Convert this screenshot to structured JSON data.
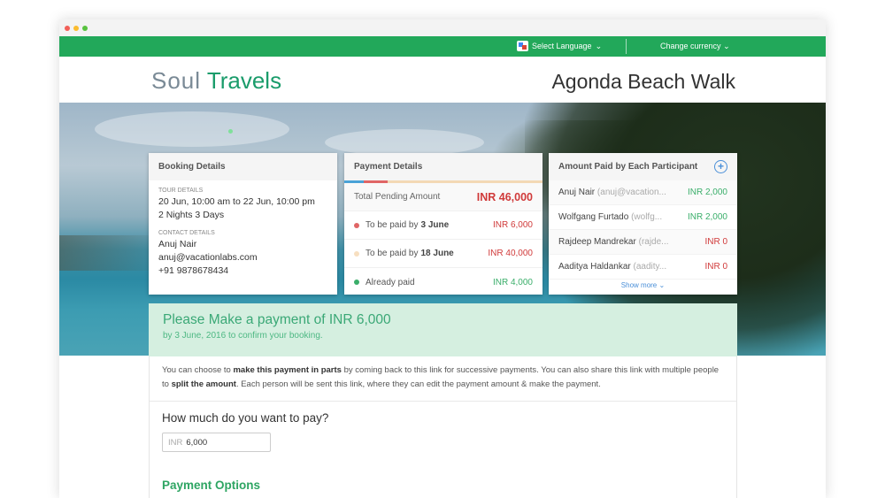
{
  "topbar": {
    "language_label": "Select Language",
    "currency_label": "Change currency"
  },
  "header": {
    "logo_part1": "Soul",
    "logo_part2": "Travels",
    "tour_title": "Agonda Beach Walk"
  },
  "booking": {
    "title": "Booking Details",
    "tour_label": "Tour Details",
    "tour_dates": "20 Jun, 10:00 am to 22 Jun, 10:00 pm",
    "tour_duration": "2 Nights 3 Days",
    "contact_label": "Contact Details",
    "contact_name": "Anuj Nair",
    "contact_email": "anuj@vacationlabs.com",
    "contact_phone": "+91 9878678434"
  },
  "payment": {
    "title": "Payment Details",
    "total_label": "Total Pending Amount",
    "total_amount": "INR 46,000",
    "rows": [
      {
        "label": "To be paid by",
        "date": "3 June",
        "amount": "INR 6,000",
        "bullet_color": "#e06666",
        "amount_color": "red"
      },
      {
        "label": "To be paid by",
        "date": "18 June",
        "amount": "INR 40,000",
        "bullet_color": "#f7dfc0",
        "amount_color": "red"
      },
      {
        "label": "Already paid",
        "date": "",
        "amount": "INR 4,000",
        "bullet_color": "#3aae6a",
        "amount_color": "green"
      }
    ]
  },
  "participants": {
    "title": "Amount Paid by Each Participant",
    "rows": [
      {
        "name": "Anuj Nair",
        "email": "(anuj@vacation...",
        "amount": "INR 2,000",
        "color": "green"
      },
      {
        "name": "Wolfgang Furtado",
        "email": "(wolfg...",
        "amount": "INR 2,000",
        "color": "green"
      },
      {
        "name": "Rajdeep Mandrekar",
        "email": "(rajde...",
        "amount": "INR 0",
        "color": "red"
      },
      {
        "name": "Aaditya Haldankar",
        "email": "(aadity...",
        "amount": "INR 0",
        "color": "red"
      }
    ],
    "show_more": "Show more"
  },
  "notice": {
    "heading": "Please Make a payment of INR 6,000",
    "subtext": "by 3 June, 2016 to confirm your booking."
  },
  "info": {
    "text1": "You can choose to ",
    "bold1": "make this payment in parts",
    "text2": " by coming back to this link for successive payments. You can also share this link with multiple people to ",
    "bold2": "split the amount",
    "text3": ". Each person will be sent this link, where they can edit the payment amount & make the payment."
  },
  "form": {
    "question": "How much do you want to pay?",
    "currency": "INR",
    "amount_value": "6,000",
    "options_title": "Payment Options"
  },
  "colors": {
    "brand_green": "#22a85a",
    "notice_bg": "#d5efe0",
    "due_red": "#d03a3a",
    "paid_green": "#3aae6a"
  }
}
